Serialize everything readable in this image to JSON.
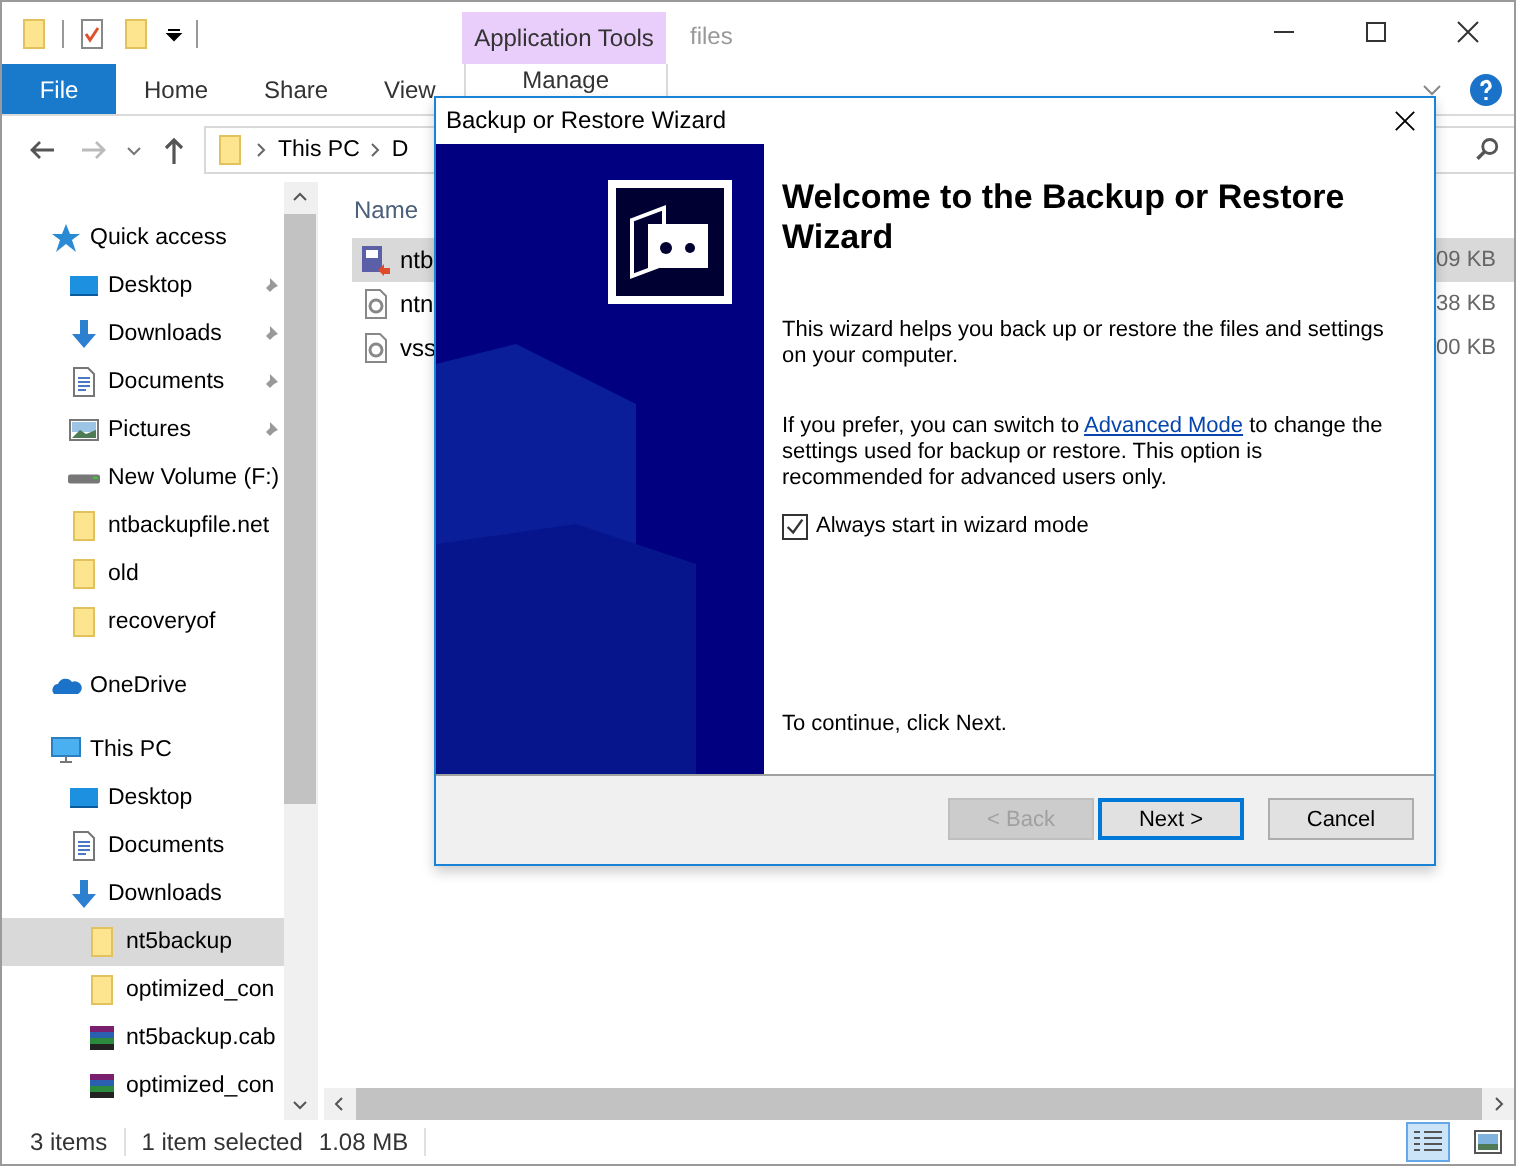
{
  "window": {
    "title": "files",
    "context_tab": "Application Tools"
  },
  "ribbon_tabs": [
    {
      "label": "File",
      "kind": "file"
    },
    {
      "label": "Home",
      "kind": "normal"
    },
    {
      "label": "Share",
      "kind": "normal"
    },
    {
      "label": "View",
      "kind": "normal"
    },
    {
      "label": "Manage",
      "kind": "contextual"
    }
  ],
  "address": {
    "segments": [
      "This PC",
      "D"
    ]
  },
  "nav_pane": {
    "items": [
      {
        "label": "Quick access",
        "kind": "star",
        "selected": false,
        "children": [
          {
            "label": "Desktop",
            "kind": "desktop",
            "pinned": true,
            "selected": false
          },
          {
            "label": "Downloads",
            "kind": "download",
            "pinned": true,
            "selected": false
          },
          {
            "label": "Documents",
            "kind": "document",
            "pinned": true,
            "selected": false
          },
          {
            "label": "Pictures",
            "kind": "pictures",
            "pinned": true,
            "selected": false
          },
          {
            "label": "New Volume (F:)",
            "kind": "drive",
            "pinned": false,
            "selected": false
          },
          {
            "label": "ntbackupfile.net",
            "kind": "folder",
            "pinned": false,
            "selected": false
          },
          {
            "label": "old",
            "kind": "folder",
            "pinned": false,
            "selected": false
          },
          {
            "label": "recoveryof",
            "kind": "folder",
            "pinned": false,
            "selected": false
          }
        ]
      },
      {
        "label": "OneDrive",
        "kind": "cloud",
        "selected": false
      },
      {
        "label": "This PC",
        "kind": "pc",
        "selected": false,
        "children": [
          {
            "label": "Desktop",
            "kind": "desktop",
            "selected": false
          },
          {
            "label": "Documents",
            "kind": "document",
            "selected": false
          },
          {
            "label": "Downloads",
            "kind": "download",
            "selected": false,
            "children": [
              {
                "label": "nt5backup",
                "kind": "folder",
                "selected": true
              },
              {
                "label": "optimized_con",
                "kind": "folder",
                "selected": false
              },
              {
                "label": "nt5backup.cab",
                "kind": "archive",
                "selected": false
              },
              {
                "label": "optimized_con",
                "kind": "archive",
                "selected": false
              }
            ]
          }
        ]
      }
    ]
  },
  "file_list": {
    "columns": [
      "Name"
    ],
    "rows": [
      {
        "name": "ntb",
        "size": "09 KB",
        "kind": "backup",
        "selected": true
      },
      {
        "name": "ntn",
        "size": "38 KB",
        "kind": "settings-file",
        "selected": false
      },
      {
        "name": "vss",
        "size": "00 KB",
        "kind": "settings-file",
        "selected": false
      }
    ]
  },
  "status_bar": {
    "count": "3 items",
    "selection": "1 item selected",
    "size": "1.08 MB",
    "view_buttons": [
      {
        "kind": "details",
        "selected": true
      },
      {
        "kind": "thumbnails",
        "selected": false
      }
    ]
  },
  "dialog": {
    "title": "Backup or Restore Wizard",
    "heading": "Welcome to the Backup or Restore Wizard",
    "intro": "This wizard helps you back up or restore the files and settings on your computer.",
    "prefer_before": "If you prefer, you can switch to",
    "link": "Advanced Mode",
    "prefer_after": "to change the settings used for backup or restore. This option is recommended for advanced users only.",
    "checkbox": {
      "label": "Always start in wizard mode",
      "checked": true
    },
    "continue": "To continue, click Next.",
    "buttons": [
      {
        "label": "< Back",
        "disabled": true,
        "default": false
      },
      {
        "label": "Next >",
        "disabled": false,
        "default": true
      },
      {
        "label": "Cancel",
        "disabled": false,
        "default": false
      }
    ]
  }
}
